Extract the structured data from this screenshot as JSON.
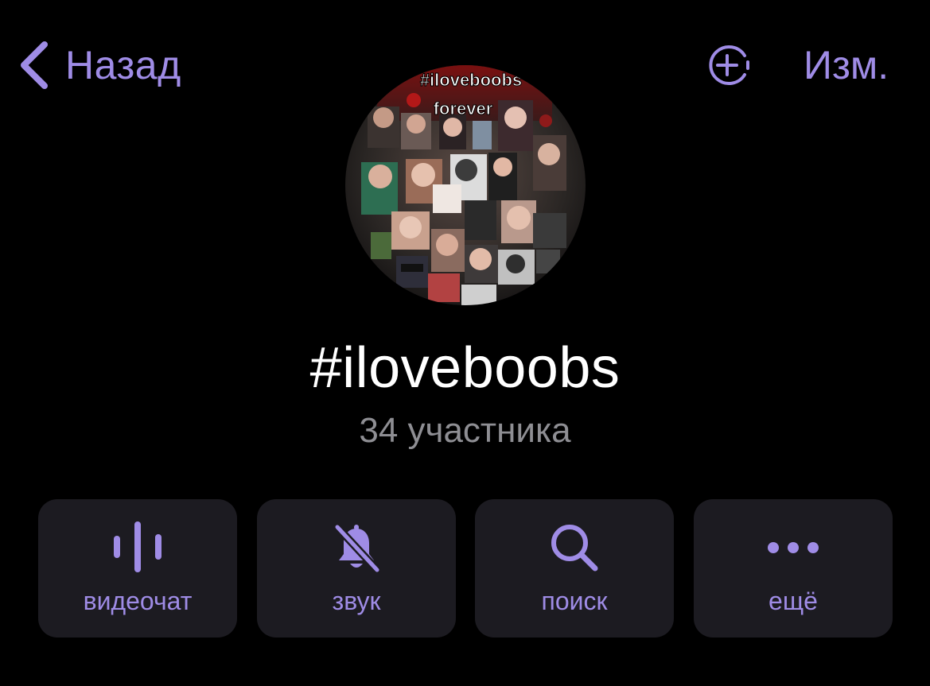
{
  "header": {
    "back_label": "Назад",
    "edit_label": "Изм."
  },
  "avatar": {
    "text_line1": "#iloveboobs",
    "text_line2": "forever"
  },
  "profile": {
    "title": "#iloveboobs",
    "subtitle": "34 участника"
  },
  "actions": [
    {
      "label": "видеочат",
      "icon": "voice-chat-icon"
    },
    {
      "label": "звук",
      "icon": "bell-slash-icon"
    },
    {
      "label": "поиск",
      "icon": "search-icon"
    },
    {
      "label": "ещё",
      "icon": "more-icon"
    }
  ],
  "colors": {
    "accent": "#9f8ce6",
    "background": "#000000",
    "card": "#1c1b21",
    "secondary_text": "#8e8e93"
  }
}
